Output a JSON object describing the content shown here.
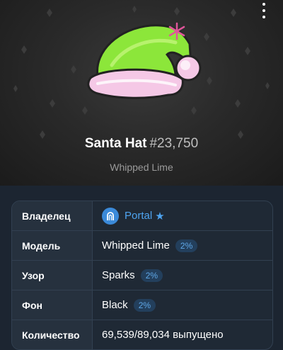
{
  "gift": {
    "name": "Santa Hat",
    "number": "#23,750",
    "model_subtitle": "Whipped Lime"
  },
  "menu_icon": "more-vertical-icon",
  "details": [
    {
      "key": "owner",
      "label": "Владелец",
      "value": "Portal",
      "icon": "portal-avatar-icon",
      "verified_icon": "star-icon"
    },
    {
      "key": "model",
      "label": "Модель",
      "value": "Whipped Lime",
      "badge": "2%"
    },
    {
      "key": "pattern",
      "label": "Узор",
      "value": "Sparks",
      "badge": "2%"
    },
    {
      "key": "backdrop",
      "label": "Фон",
      "value": "Black",
      "badge": "2%"
    },
    {
      "key": "quantity",
      "label": "Количество",
      "value": "69,539/89,034 выпущено"
    }
  ],
  "colors": {
    "link": "#4ea4f0",
    "badge_bg": "#233f5c",
    "hat_green": "#8ce63a",
    "fur_pink": "#f5c8e6",
    "table_bg": "#1f2935"
  }
}
